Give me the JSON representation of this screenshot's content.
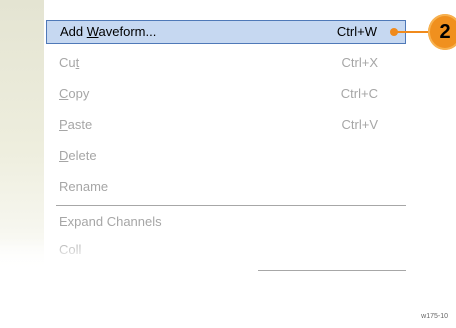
{
  "menu": {
    "items": [
      {
        "label_pre": "Add ",
        "label_mnemonic": "W",
        "label_post": "aveform...",
        "shortcut": "Ctrl+W"
      },
      {
        "label_pre": "Cu",
        "label_mnemonic": "t",
        "label_post": "",
        "shortcut": "Ctrl+X"
      },
      {
        "label_pre": "",
        "label_mnemonic": "C",
        "label_post": "opy",
        "shortcut": "Ctrl+C"
      },
      {
        "label_pre": "",
        "label_mnemonic": "P",
        "label_post": "aste",
        "shortcut": "Ctrl+V"
      },
      {
        "label_pre": "",
        "label_mnemonic": "D",
        "label_post": "elete",
        "shortcut": ""
      },
      {
        "label_pre": "Rename",
        "label_mnemonic": "",
        "label_post": "",
        "shortcut": ""
      },
      {
        "label_pre": "Expand Channels",
        "label_mnemonic": "",
        "label_post": "",
        "shortcut": ""
      },
      {
        "label_pre": "Coll",
        "label_mnemonic": "",
        "label_post": "",
        "shortcut": ""
      }
    ]
  },
  "callout": {
    "number": "2",
    "color": "#f0901e"
  },
  "figure_id": "w175-10",
  "colors": {
    "highlight_bg": "#c6d8f1",
    "highlight_border": "#4f79b8",
    "disabled_text": "#a6a6a6"
  }
}
